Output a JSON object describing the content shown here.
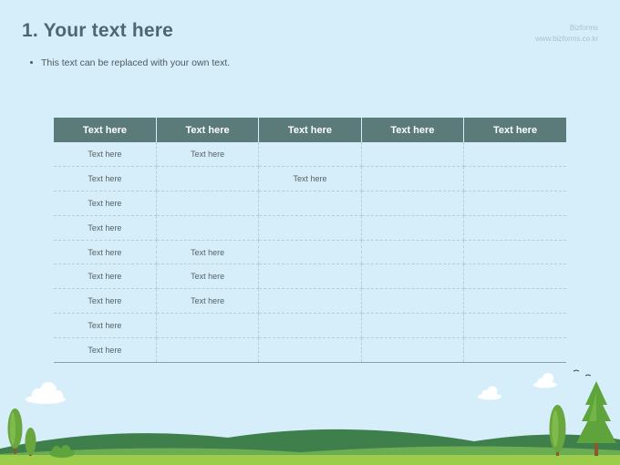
{
  "slide": {
    "title": "1. Your text here",
    "brand_name": "Bizforms",
    "brand_url": "www.bizforms.co.kr",
    "bullet": "This text can be replaced with your own text."
  },
  "table": {
    "headers": [
      "Text here",
      "Text here",
      "Text here",
      "Text here",
      "Text here"
    ],
    "rows": [
      [
        "Text here",
        "Text here",
        "",
        "",
        ""
      ],
      [
        "Text here",
        "",
        "Text here",
        "",
        ""
      ],
      [
        "Text here",
        "",
        "",
        "",
        ""
      ],
      [
        "Text here",
        "",
        "",
        "",
        ""
      ],
      [
        "Text here",
        "Text here",
        "",
        "",
        ""
      ],
      [
        "Text here",
        "Text here",
        "",
        "",
        ""
      ],
      [
        "Text here",
        "Text here",
        "",
        "",
        ""
      ],
      [
        "Text here",
        "",
        "",
        "",
        ""
      ],
      [
        "Text here",
        "",
        "",
        "",
        ""
      ]
    ]
  },
  "colors": {
    "background": "#d6eefa",
    "title": "#4e6670",
    "table_header": "#5b7b7b",
    "hill_dark": "#3e7f4c",
    "hill_light": "#6cac52",
    "ground": "#9bcc4a",
    "tree_green": "#5ea33c"
  },
  "decorations": [
    "cloud-icon",
    "tree-icon",
    "bird-icon",
    "hill-icon",
    "bush-icon"
  ]
}
